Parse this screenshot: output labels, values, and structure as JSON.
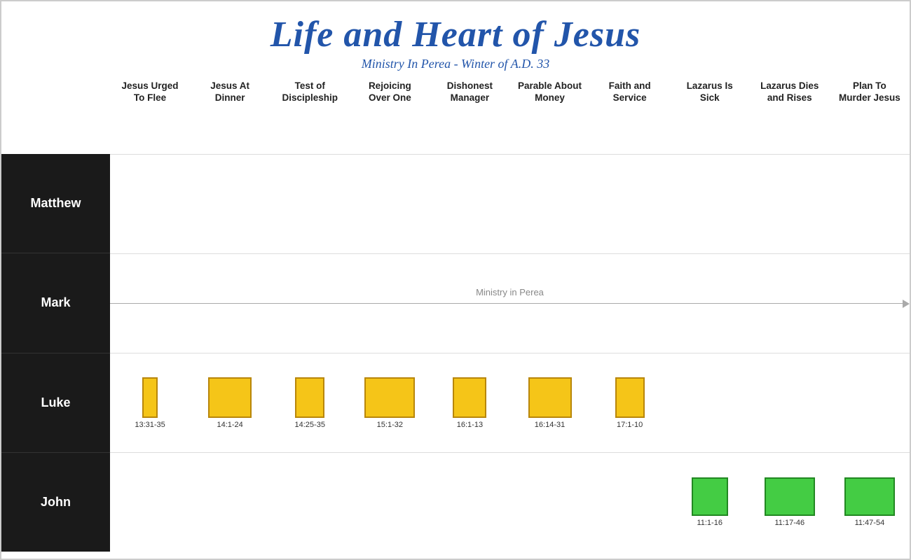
{
  "header": {
    "title": "Life and Heart of Jesus",
    "subtitle": "Ministry In Perea - Winter of A.D. 33"
  },
  "columns": [
    {
      "id": "col1",
      "label": "Jesus Urged\nTo Flee"
    },
    {
      "id": "col2",
      "label": "Jesus At\nDinner"
    },
    {
      "id": "col3",
      "label": "Test of\nDiscipleship"
    },
    {
      "id": "col4",
      "label": "Rejoicing\nOver One"
    },
    {
      "id": "col5",
      "label": "Dishonest\nManager"
    },
    {
      "id": "col6",
      "label": "Parable About\nMoney"
    },
    {
      "id": "col7",
      "label": "Faith and\nService"
    },
    {
      "id": "col8",
      "label": "Lazarus Is\nSick"
    },
    {
      "id": "col9",
      "label": "Lazarus Dies\nand Rises"
    },
    {
      "id": "col10",
      "label": "Plan To\nMurder Jesus"
    }
  ],
  "rows": [
    {
      "id": "matthew",
      "label": "Matthew",
      "type": "empty"
    },
    {
      "id": "mark",
      "label": "Mark",
      "type": "arrow",
      "arrowLabel": "Ministry in Perea"
    },
    {
      "id": "luke",
      "label": "Luke",
      "type": "blocks",
      "blocks": [
        {
          "col": 0,
          "color": "yellow",
          "width": 22,
          "height": 58,
          "ref": "13:31-35"
        },
        {
          "col": 1,
          "color": "yellow",
          "width": 62,
          "height": 58,
          "ref": "14:1-24"
        },
        {
          "col": 2,
          "color": "yellow",
          "width": 42,
          "height": 58,
          "ref": "14:25-35"
        },
        {
          "col": 3,
          "color": "yellow",
          "width": 72,
          "height": 58,
          "ref": "15:1-32"
        },
        {
          "col": 4,
          "color": "yellow",
          "width": 48,
          "height": 58,
          "ref": "16:1-13"
        },
        {
          "col": 5,
          "color": "yellow",
          "width": 62,
          "height": 58,
          "ref": "16:14-31"
        },
        {
          "col": 6,
          "color": "yellow",
          "width": 42,
          "height": 58,
          "ref": "17:1-10"
        },
        {
          "col": 7,
          "color": "none",
          "width": 0,
          "height": 0,
          "ref": ""
        },
        {
          "col": 8,
          "color": "none",
          "width": 0,
          "height": 0,
          "ref": ""
        },
        {
          "col": 9,
          "color": "none",
          "width": 0,
          "height": 0,
          "ref": ""
        }
      ]
    },
    {
      "id": "john",
      "label": "John",
      "type": "blocks",
      "blocks": [
        {
          "col": 0,
          "color": "none",
          "width": 0,
          "height": 0,
          "ref": ""
        },
        {
          "col": 1,
          "color": "none",
          "width": 0,
          "height": 0,
          "ref": ""
        },
        {
          "col": 2,
          "color": "none",
          "width": 0,
          "height": 0,
          "ref": ""
        },
        {
          "col": 3,
          "color": "none",
          "width": 0,
          "height": 0,
          "ref": ""
        },
        {
          "col": 4,
          "color": "none",
          "width": 0,
          "height": 0,
          "ref": ""
        },
        {
          "col": 5,
          "color": "none",
          "width": 0,
          "height": 0,
          "ref": ""
        },
        {
          "col": 6,
          "color": "none",
          "width": 0,
          "height": 0,
          "ref": ""
        },
        {
          "col": 7,
          "color": "green",
          "width": 52,
          "height": 55,
          "ref": "11:1-16"
        },
        {
          "col": 8,
          "color": "green",
          "width": 72,
          "height": 55,
          "ref": "11:17-46"
        },
        {
          "col": 9,
          "color": "green",
          "width": 72,
          "height": 55,
          "ref": "11:47-54"
        }
      ]
    }
  ]
}
